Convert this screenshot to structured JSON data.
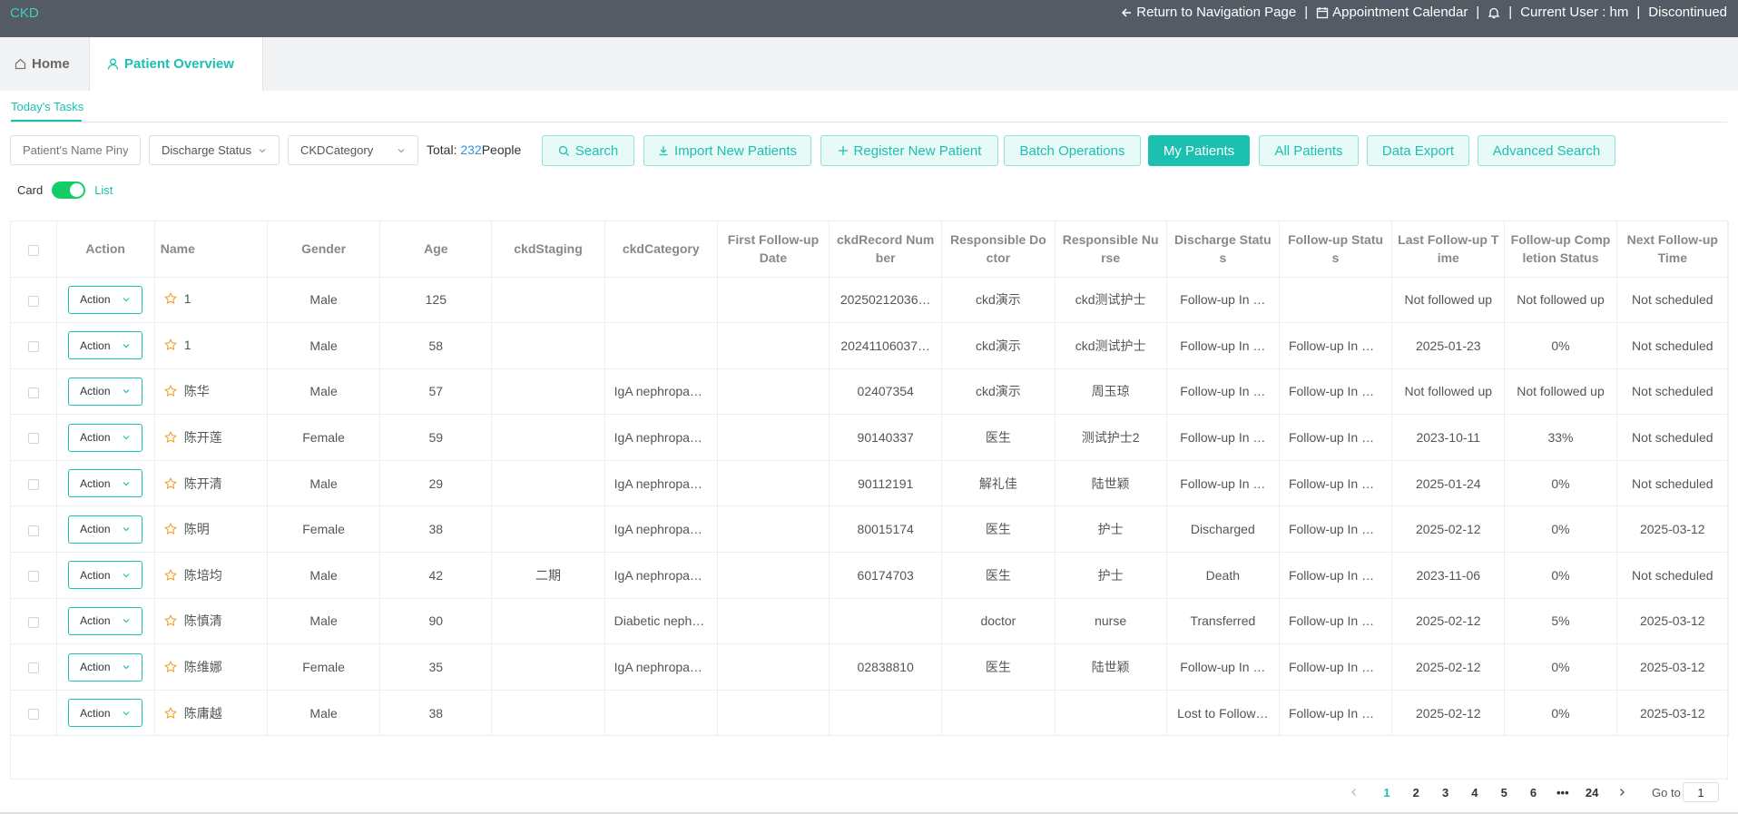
{
  "app": {
    "brand": "CKD"
  },
  "header": {
    "return_label": "Return to Navigation Page",
    "calendar_label": "Appointment Calendar",
    "user_label": "Current User : hm",
    "logout_label": "Discontinued",
    "separator": "|"
  },
  "tabs": {
    "home": "Home",
    "patient_overview": "Patient Overview"
  },
  "subtab": {
    "label": "Today's Tasks"
  },
  "filters": {
    "name_placeholder": "Patient's Name Pinyi",
    "discharge_status": "Discharge Status",
    "ckd_category": "CKDCategory"
  },
  "total": {
    "prefix": "Total:",
    "count": "232",
    "suffix": "People"
  },
  "toolbar": {
    "search": "Search",
    "import": "Import New Patients",
    "register": "Register New Patient",
    "batch": "Batch Operations",
    "my_patients": "My Patients",
    "all_patients": "All Patients",
    "export": "Data Export",
    "advanced": "Advanced Search"
  },
  "view_toggle": {
    "card": "Card",
    "list": "List"
  },
  "table": {
    "headers": {
      "action": "Action",
      "name": "Name",
      "gender": "Gender",
      "age": "Age",
      "staging": "ckdStaging",
      "category": "ckdCategory",
      "first_followup": "First Follow-up Date",
      "record_no": "ckdRecord Number",
      "doctor": "Responsible Doctor",
      "nurse": "Responsible Nurse",
      "discharge": "Discharge Status",
      "followup_status": "Follow-up Status",
      "last_followup": "Last Follow-up Time",
      "completion": "Follow-up Completion Status",
      "next_followup": "Next Follow-up Time"
    },
    "action_label": "Action",
    "rows": [
      {
        "name": "1",
        "gender": "Male",
        "age": "125",
        "staging": "",
        "category": "",
        "first": "",
        "record": "20250212036…",
        "doctor": "ckd演示",
        "nurse": "ckd测试护士",
        "discharge": "Follow-up In …",
        "status": "",
        "last": "Not followed up",
        "completion": "Not followed up",
        "next": "Not scheduled"
      },
      {
        "name": "1",
        "gender": "Male",
        "age": "58",
        "staging": "",
        "category": "",
        "first": "",
        "record": "20241106037…",
        "doctor": "ckd演示",
        "nurse": "ckd测试护士",
        "discharge": "Follow-up In …",
        "status": "Follow-up In …",
        "last": "2025-01-23",
        "completion": "0%",
        "next": "Not scheduled"
      },
      {
        "name": "陈华",
        "gender": "Male",
        "age": "57",
        "staging": "",
        "category": "IgA nephropa…",
        "first": "",
        "record": "02407354",
        "doctor": "ckd演示",
        "nurse": "周玉琼",
        "discharge": "Follow-up In …",
        "status": "Follow-up In …",
        "last": "Not followed up",
        "completion": "Not followed up",
        "next": "Not scheduled"
      },
      {
        "name": "陈开莲",
        "gender": "Female",
        "age": "59",
        "staging": "",
        "category": "IgA nephropa…",
        "first": "",
        "record": "90140337",
        "doctor": "医生",
        "nurse": "测试护士2",
        "discharge": "Follow-up In …",
        "status": "Follow-up In …",
        "last": "2023-10-11",
        "completion": "33%",
        "next": "Not scheduled"
      },
      {
        "name": "陈开清",
        "gender": "Male",
        "age": "29",
        "staging": "",
        "category": "IgA nephropa…",
        "first": "",
        "record": "90112191",
        "doctor": "解礼佳",
        "nurse": "陆世颖",
        "discharge": "Follow-up In …",
        "status": "Follow-up In …",
        "last": "2025-01-24",
        "completion": "0%",
        "next": "Not scheduled"
      },
      {
        "name": "陈明",
        "gender": "Female",
        "age": "38",
        "staging": "",
        "category": "IgA nephropa…",
        "first": "",
        "record": "80015174",
        "doctor": "医生",
        "nurse": "护士",
        "discharge": "Discharged",
        "status": "Follow-up In …",
        "last": "2025-02-12",
        "completion": "0%",
        "next": "2025-03-12"
      },
      {
        "name": "陈培均",
        "gender": "Male",
        "age": "42",
        "staging": "二期",
        "category": "IgA nephropa…",
        "first": "",
        "record": "60174703",
        "doctor": "医生",
        "nurse": "护士",
        "discharge": "Death",
        "status": "Follow-up In …",
        "last": "2023-11-06",
        "completion": "0%",
        "next": "Not scheduled"
      },
      {
        "name": "陈慎清",
        "gender": "Male",
        "age": "90",
        "staging": "",
        "category": "Diabetic neph…",
        "first": "",
        "record": "",
        "doctor": "doctor",
        "nurse": "nurse",
        "discharge": "Transferred",
        "status": "Follow-up In …",
        "last": "2025-02-12",
        "completion": "5%",
        "next": "2025-03-12"
      },
      {
        "name": "陈维娜",
        "gender": "Female",
        "age": "35",
        "staging": "",
        "category": "IgA nephropa…",
        "first": "",
        "record": "02838810",
        "doctor": "医生",
        "nurse": "陆世颖",
        "discharge": "Follow-up In …",
        "status": "Follow-up In …",
        "last": "2025-02-12",
        "completion": "0%",
        "next": "2025-03-12"
      },
      {
        "name": "陈庸越",
        "gender": "Male",
        "age": "38",
        "staging": "",
        "category": "",
        "first": "",
        "record": "",
        "doctor": "",
        "nurse": "",
        "discharge": "Lost to Follow…",
        "status": "Follow-up In …",
        "last": "2025-02-12",
        "completion": "0%",
        "next": "2025-03-12"
      }
    ]
  },
  "pagination": {
    "pages": [
      "1",
      "2",
      "3",
      "4",
      "5",
      "6",
      "•••",
      "24"
    ],
    "current": "1",
    "goto_label": "Go to",
    "goto_value": "1"
  },
  "icons": {
    "star": "star-icon",
    "home": "home-icon",
    "user": "user-icon",
    "bell": "bell-icon",
    "calendar": "calendar-icon",
    "arrow_left": "arrow-left-icon"
  },
  "colors": {
    "accent": "#1cc0b0",
    "topbar": "#545b64",
    "star": "#f0a030",
    "switch_on": "#13ce66"
  }
}
